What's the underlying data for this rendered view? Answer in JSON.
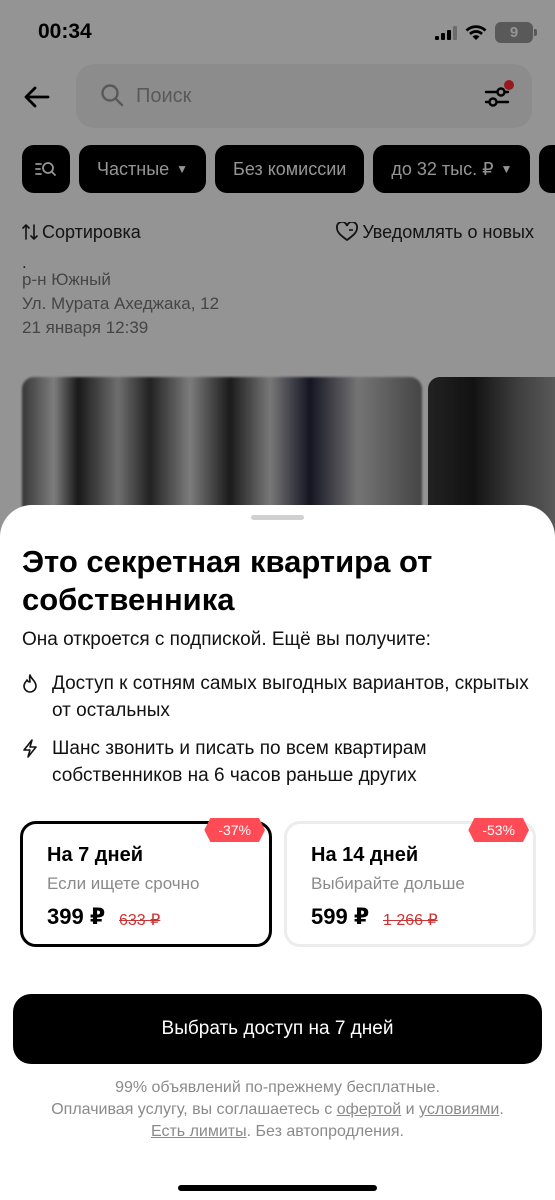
{
  "status_bar": {
    "time": "00:34",
    "battery": "9"
  },
  "search": {
    "placeholder": "Поиск"
  },
  "chips": [
    "Частные",
    "Без комиссии",
    "до 32 тыс. ₽"
  ],
  "sort_label": "Сортировка",
  "notify_label": "Уведомлять о новых",
  "listing": {
    "dot": ".",
    "district": "р-н Южный",
    "address": "Ул. Мурата Ахеджака, 12",
    "date": "21 января 12:39"
  },
  "sheet": {
    "title": "Это секретная квартира от собственника",
    "subtitle": "Она откроется с подпиской. Ещё вы получите:",
    "features": [
      "Доступ к сотням самых выгодных вариантов, скрытых от остальных",
      "Шанс звонить и писать по всем квартирам собственников на 6 часов раньше других"
    ],
    "plans": [
      {
        "name": "На 7 дней",
        "desc": "Если ищете срочно",
        "price": "399 ₽",
        "old_price": "633 ₽",
        "discount": "-37%",
        "selected": true
      },
      {
        "name": "На 14 дней",
        "desc": "Выбирайте дольше",
        "price": "599 ₽",
        "old_price": "1 266 ₽",
        "discount": "-53%",
        "selected": false
      }
    ],
    "cta": "Выбрать доступ на 7 дней",
    "footnote": {
      "line1": "99% объявлений по-прежнему бесплатные.",
      "line2_prefix": "Оплачивая услугу, вы соглашаетесь с",
      "offer_link": "офертой",
      "and": "и",
      "terms_link": "условиями",
      "line2_suffix": ".",
      "limits_link": "Есть лимиты",
      "line3_suffix": ". Без автопродления."
    }
  },
  "colors": {
    "accent": "#ff4b55",
    "primary": "#000000",
    "muted": "#8a8a8a"
  }
}
